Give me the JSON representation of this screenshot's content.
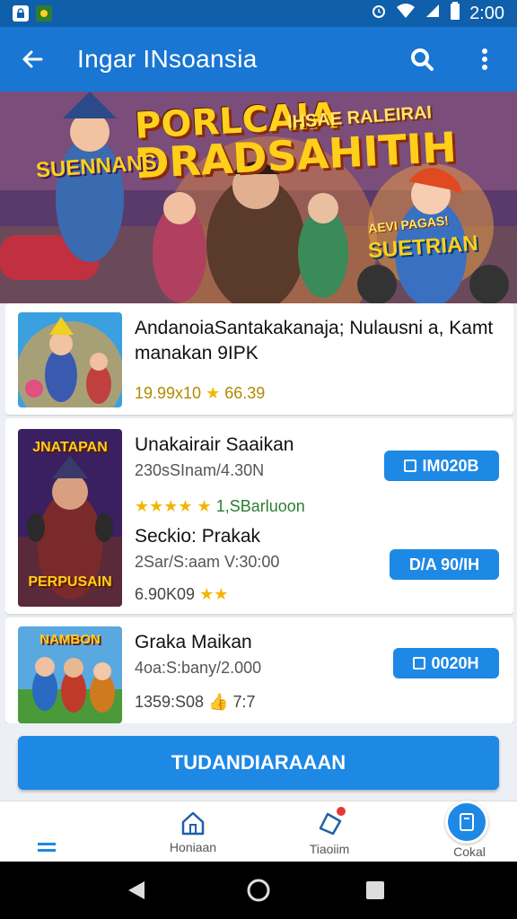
{
  "status_bar": {
    "time": "2:00"
  },
  "app_bar": {
    "title": "Ingar INsoansia"
  },
  "banner": {
    "title_line_1": "PORLCAIA",
    "title_line_2": "DRADSAHITIH",
    "subtitle": "IHSAE RALEIRAI",
    "tag": "AEVI PAGAS!",
    "badge_left": "SUENNANS",
    "badge_right": "SUETRIAN"
  },
  "cards": [
    {
      "title": "AndanoiaSantakakanaja; Nulausni a, Kamt",
      "title2": "manakan 9IPK",
      "rating_value": "19.99x10",
      "rating_text": "66.39"
    },
    {
      "title": "Unakairair Saaikan",
      "meta": "230sSInam/4.30N",
      "stars_text": "1,SBarluoon",
      "button": "IM020B",
      "title2": "Seckio: Prakak",
      "meta2": "2Sar/S:aam V:30:00",
      "button2": "D/A 90/IH",
      "rating_value": "6.90K09",
      "thumb_caption_top": "JNATAPAN",
      "thumb_caption_bottom": "PERPUSAIN"
    },
    {
      "title": "Graka Maikan",
      "meta": "4oa:S:bany/2.000",
      "rating_value": "1359:S08",
      "rating_text": "7:7",
      "button": "0020H",
      "thumb_caption_top": "NAMBON"
    }
  ],
  "cta": {
    "label": "TUDANDIARAAAN"
  },
  "bottom_nav": {
    "items": [
      {
        "label": ""
      },
      {
        "label": "Honiaan"
      },
      {
        "label": "Tiaoiim"
      },
      {
        "label": "Cokal"
      }
    ]
  },
  "colors": {
    "primary": "#1976d2",
    "accent": "#1e88e5",
    "star": "#f2b600"
  }
}
